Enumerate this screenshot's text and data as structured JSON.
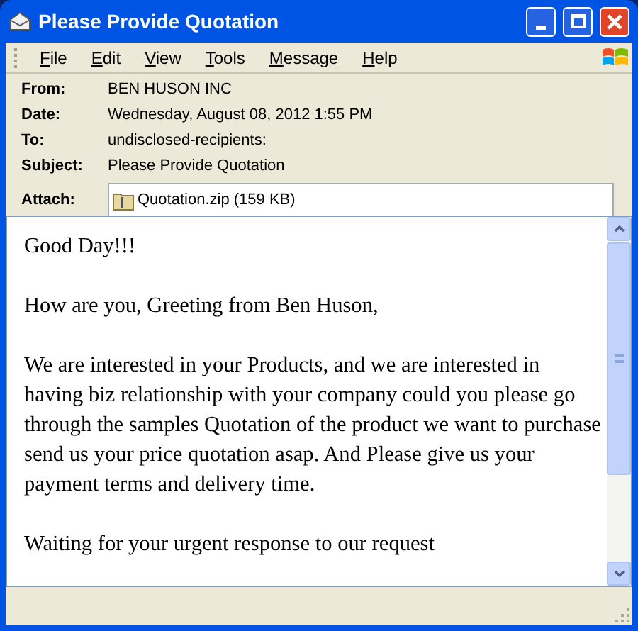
{
  "window": {
    "title": "Please Provide Quotation"
  },
  "menu": [
    "File",
    "Edit",
    "View",
    "Tools",
    "Message",
    "Help"
  ],
  "header": [
    {
      "label": "From:",
      "value": "BEN HUSON INC"
    },
    {
      "label": "Date:",
      "value": "Wednesday, August 08, 2012 1:55 PM"
    },
    {
      "label": "To:",
      "value": "undisclosed-recipients:"
    },
    {
      "label": "Subject:",
      "value": "Please Provide Quotation"
    }
  ],
  "attach": {
    "label": "Attach:",
    "file": "Quotation.zip (159 KB)"
  },
  "body": [
    "Good Day!!!",
    "How are you, Greeting from Ben Huson,",
    "We are interested in your Products, and we are interested in having biz relationship with your company could you please go through the samples Quotation of the product we want to purchase  send us your price quotation asap. And Please give us your payment terms and delivery time.",
    "Waiting for your urgent response to our request"
  ]
}
